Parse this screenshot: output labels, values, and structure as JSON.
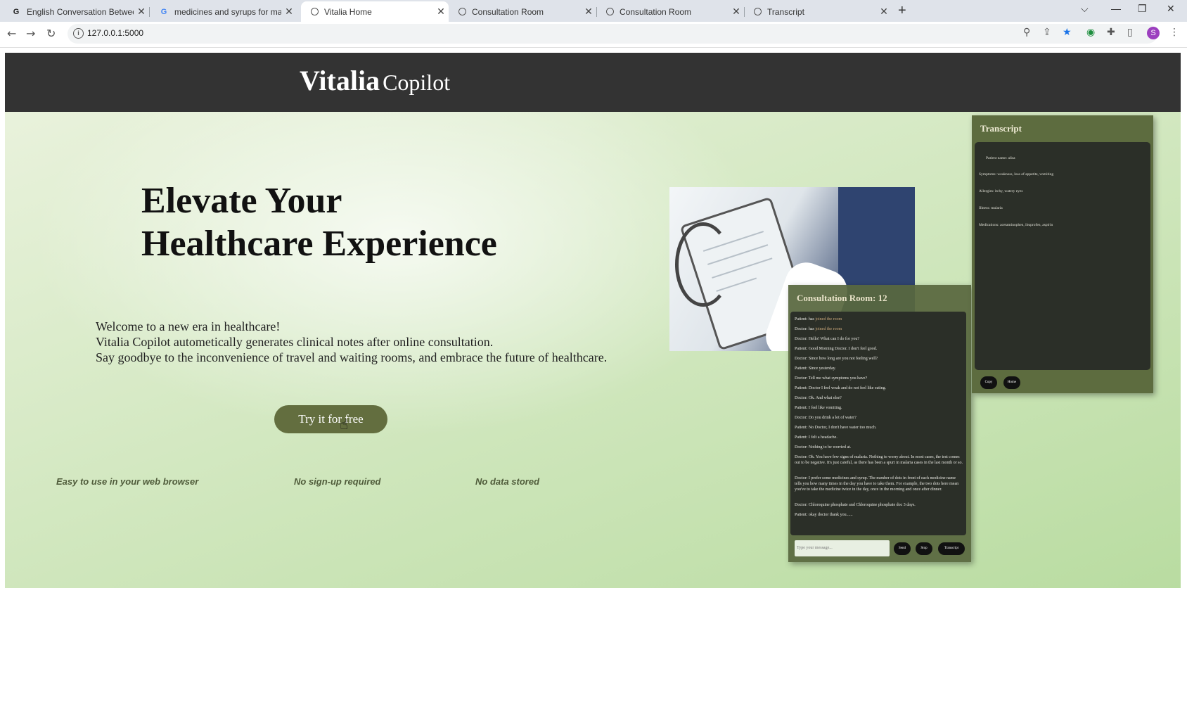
{
  "browser": {
    "tabs": [
      {
        "title": "English Conversation Between Do",
        "icon": "google-icon"
      },
      {
        "title": "medicines and syrups for maleria",
        "icon": "google-icon"
      },
      {
        "title": "Vitalia Home",
        "icon": "globe-icon",
        "active": true
      },
      {
        "title": "Consultation Room",
        "icon": "globe-icon"
      },
      {
        "title": "Consultation Room",
        "icon": "globe-icon"
      },
      {
        "title": "Transcript",
        "icon": "globe-icon"
      }
    ],
    "url": "127.0.0.1:5000",
    "profile_initial": "S"
  },
  "header": {
    "brand_bold": "Vitalia",
    "brand_light": "Copilot"
  },
  "hero": {
    "title_line1": "Elevate Your",
    "title_line2": "Healthcare Experience",
    "text_line1": "Welcome to a new era in healthcare!",
    "text_line2": "Vitalia Copilot autometically generates clinical notes after online consultation.",
    "text_line3": "Say goodbye to the inconvenience of travel and waiting rooms, and embrace the future of healthcare.",
    "cta_label": "Try it for free",
    "features": [
      "Easy to use in your web browser",
      "No sign-up required",
      "No data stored"
    ]
  },
  "consultation": {
    "title": "Consultation Room: 12",
    "messages": [
      {
        "speaker": "Patient:",
        "text": "has",
        "join": "joined the room"
      },
      {
        "speaker": "Doctor:",
        "text": "has",
        "join": "joined the room"
      },
      {
        "speaker": "Doctor:",
        "text": "Hello! What can I do for you?"
      },
      {
        "speaker": "Patient:",
        "text": "Good Morning Doctor. I don't feel good."
      },
      {
        "speaker": "Doctor:",
        "text": "Since how long are you not feeling well?"
      },
      {
        "speaker": "Patient:",
        "text": "Since yesterday."
      },
      {
        "speaker": "Doctor:",
        "text": "Tell me what symptoms you have?"
      },
      {
        "speaker": "Patient:",
        "text": "Doctor I feel weak and do not feel like eating."
      },
      {
        "speaker": "Doctor:",
        "text": "Ok. And what else?"
      },
      {
        "speaker": "Patient:",
        "text": "I feel like vomiting."
      },
      {
        "speaker": "Doctor:",
        "text": "Do you drink a lot of water?"
      },
      {
        "speaker": "Patient:",
        "text": "No Doctor, I don't have water too much."
      },
      {
        "speaker": "Patient:",
        "text": "I felt a headache."
      },
      {
        "speaker": "Doctor:",
        "text": "Nothing to be worried at."
      },
      {
        "speaker": "Doctor:",
        "text": "Ok. You have few signs of malaria. Nothing to worry about. In most cases, the test comes out to be negative. It's just careful, as there has been a spurt in malaria cases in the last month or so."
      },
      {
        "speaker": "Doctor:",
        "text": "I prefer some medicines and syrup. The number of dots in front of each medicine name tells you how many times in the day you have to take them. For example, the two dots here mean you've to take the medicine twice in the day, once in the morning and once after dinner."
      },
      {
        "speaker": "Doctor:",
        "text": "Chloroquine phosphate and Chloroquine phosphate doc 3 days."
      },
      {
        "speaker": "Patient:",
        "text": "okay doctor thank you......"
      }
    ],
    "input_placeholder": "Type your message...",
    "buttons": [
      "Send",
      "Stop",
      "Transcript"
    ]
  },
  "transcript": {
    "title": "Transcript",
    "lines": [
      "Patient name: alisa",
      "Symptoms: weakness, loss of appetite, vomiting",
      "Allergies: itchy, watery eyes",
      "Illness: malaria",
      "Medications: acetaminophen, ibuprofen, aspirin"
    ],
    "buttons": [
      "Copy",
      "Home"
    ]
  }
}
